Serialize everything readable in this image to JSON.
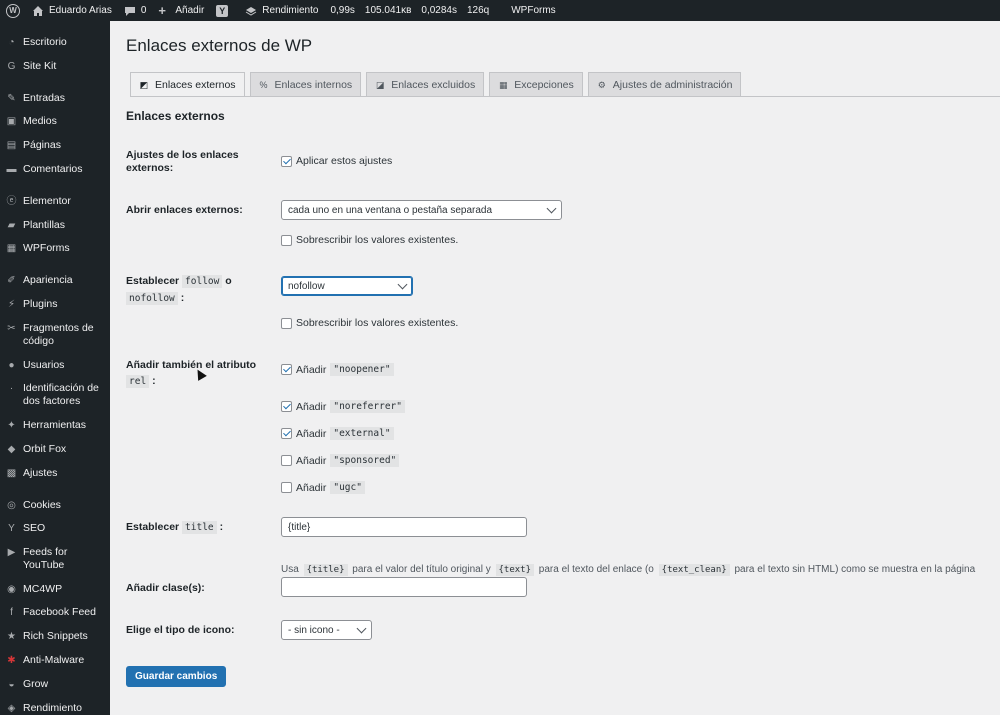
{
  "admin_bar": {
    "site_name": "Eduardo Arias",
    "comments_count": "0",
    "add_new": "Añadir",
    "performance": "Rendimiento",
    "stats": [
      "0,99s",
      "105.041ĸʙ",
      "0,0284s",
      "126q"
    ],
    "wpforms": "WPForms"
  },
  "sidebar": {
    "items": [
      {
        "label": "Escritorio",
        "icon": "dashboard-icon"
      },
      {
        "label": "Site Kit",
        "icon": "google-icon"
      },
      {
        "label": "Entradas",
        "icon": "pin-icon"
      },
      {
        "label": "Medios",
        "icon": "media-icon"
      },
      {
        "label": "Páginas",
        "icon": "pages-icon"
      },
      {
        "label": "Comentarios",
        "icon": "comments-icon"
      },
      {
        "label": "Elementor",
        "icon": "elementor-icon"
      },
      {
        "label": "Plantillas",
        "icon": "folder-icon"
      },
      {
        "label": "WPForms",
        "icon": "forms-icon"
      },
      {
        "label": "Apariencia",
        "icon": "brush-icon"
      },
      {
        "label": "Plugins",
        "icon": "plugin-icon"
      },
      {
        "label": "Fragmentos de código",
        "icon": "scissors-icon"
      },
      {
        "label": "Usuarios",
        "icon": "users-icon"
      },
      {
        "label": "Identificación de dos factores",
        "icon": "shield-icon"
      },
      {
        "label": "Herramientas",
        "icon": "wrench-icon"
      },
      {
        "label": "Orbit Fox",
        "icon": "fox-icon"
      },
      {
        "label": "Ajustes",
        "icon": "settings-icon"
      },
      {
        "label": "Cookies",
        "icon": "cookie-icon"
      },
      {
        "label": "SEO",
        "icon": "yoast-icon"
      },
      {
        "label": "Feeds for YouTube",
        "icon": "youtube-icon"
      },
      {
        "label": "MC4WP",
        "icon": "mc4wp-icon"
      },
      {
        "label": "Facebook Feed",
        "icon": "facebook-icon"
      },
      {
        "label": "Rich Snippets",
        "icon": "star-icon"
      },
      {
        "label": "Anti-Malware",
        "icon": "malware-icon"
      },
      {
        "label": "Grow",
        "icon": "grow-icon"
      },
      {
        "label": "Rendimiento",
        "icon": "performance-icon"
      }
    ]
  },
  "page": {
    "title": "Enlaces externos de WP",
    "tabs": [
      {
        "label": "Enlaces externos",
        "active": true
      },
      {
        "label": "Enlaces internos",
        "active": false
      },
      {
        "label": "Enlaces excluidos",
        "active": false
      },
      {
        "label": "Excepciones",
        "active": false
      },
      {
        "label": "Ajustes de administración",
        "active": false
      }
    ],
    "section_title": "Enlaces externos"
  },
  "form": {
    "settings_label": "Ajustes de los enlaces externos:",
    "apply_settings": "Aplicar estos ajustes",
    "open_label": "Abrir enlaces externos:",
    "open_value": "cada uno en una ventana o pestaña separada",
    "overwrite_label": "Sobrescribir los valores existentes.",
    "follow_label_pre": "Establecer",
    "follow_code": "follow",
    "follow_or": "o",
    "nofollow_code": "nofollow",
    "follow_colon": ":",
    "follow_value": "nofollow",
    "rel_label": "Añadir también el atributo",
    "rel_code": "rel",
    "rel_colon": ":",
    "add_word": "Añadir",
    "rel_options": [
      {
        "value": "\"noopener\"",
        "checked": true
      },
      {
        "value": "\"noreferrer\"",
        "checked": true
      },
      {
        "value": "\"external\"",
        "checked": true
      },
      {
        "value": "\"sponsored\"",
        "checked": false
      },
      {
        "value": "\"ugc\"",
        "checked": false
      }
    ],
    "title_label_pre": "Establecer",
    "title_code": "title",
    "title_colon": ":",
    "title_value": "{title}",
    "help": {
      "p1": "Usa",
      "c1": "{title}",
      "p2": "para el valor del título original y",
      "c2": "{text}",
      "p3": "para el texto del enlace (o",
      "c3": "{text_clean}",
      "p4": "para el texto sin HTML) como se muestra en la página"
    },
    "class_label": "Añadir clase(s):",
    "class_value": "",
    "icon_label": "Elige el tipo de icono:",
    "icon_value": "- sin icono -",
    "save_label": "Guardar cambios"
  },
  "colors": {
    "admin_bar_bg": "#1d2327",
    "accent": "#2271b1",
    "page_bg": "#f0f0f1"
  }
}
